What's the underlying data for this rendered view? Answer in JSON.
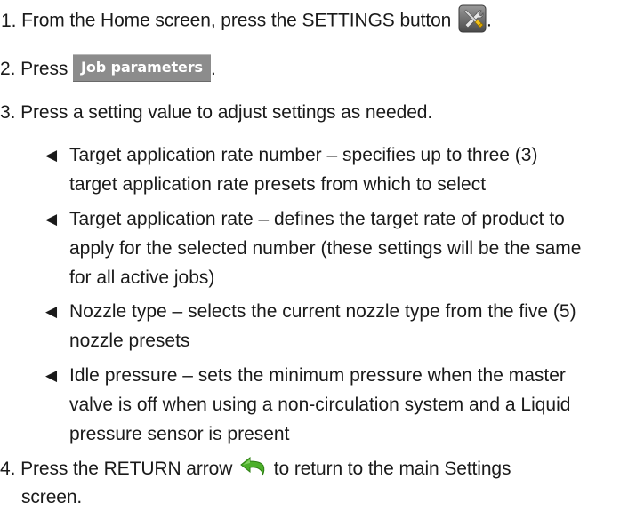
{
  "steps": [
    {
      "number": "1.",
      "text_before": "From the Home screen, press the SETTINGS button",
      "text_after": ".",
      "icon": "settings-tools-icon"
    },
    {
      "number": "2.",
      "text_before": "Press",
      "button_label": "Job parameters",
      "text_after": "."
    },
    {
      "number": "3.",
      "text": "Press a setting value to adjust settings as needed."
    },
    {
      "number": "4.",
      "text_before": "Press the RETURN arrow",
      "text_after": "to return to the main Settings",
      "text_line2": "screen.",
      "icon": "return-arrow-icon"
    }
  ],
  "bullets": [
    {
      "arrow": "◀",
      "line1": "Target application rate number – specifies up to three (3)",
      "line2": "target application rate presets from which to select"
    },
    {
      "arrow": "◀",
      "line1": "Target application rate – defines the target rate of product to",
      "line2": "apply for the selected number (these settings will be the same",
      "line3": "for all active jobs)"
    },
    {
      "arrow": "◀",
      "line1": "Nozzle type – selects the current nozzle type from the five (5)",
      "line2": "nozzle presets"
    },
    {
      "arrow": "◀",
      "line1": "Idle pressure – sets the minimum pressure when the master",
      "line2": "valve is off when using a non-circulation system and a Liquid",
      "line3": "pressure sensor is present"
    }
  ],
  "colors": {
    "text": "#1a1a1a",
    "button_bg": "#8c8c8c",
    "button_text": "#ffffff",
    "return_icon": "#4caf2a"
  }
}
